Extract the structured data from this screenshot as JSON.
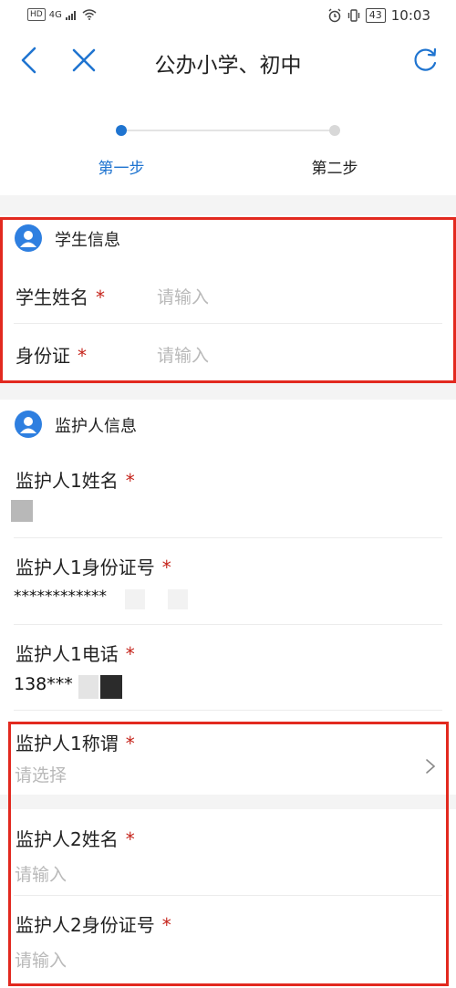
{
  "status_bar": {
    "hd": "HD",
    "network": "4G",
    "battery": "43",
    "time": "10:03"
  },
  "nav": {
    "title": "公办小学、初中"
  },
  "steps": {
    "step1": "第一步",
    "step2": "第二步"
  },
  "student_section": {
    "title": "学生信息",
    "fields": [
      {
        "label": "学生姓名",
        "required": "*",
        "placeholder": "请输入"
      },
      {
        "label": "身份证",
        "required": "*",
        "placeholder": "请输入"
      }
    ]
  },
  "guardian_section": {
    "title": "监护人信息",
    "fields": [
      {
        "label": "监护人1姓名",
        "required": "*",
        "value": ""
      },
      {
        "label": "监护人1身份证号",
        "required": "*",
        "value": "************"
      },
      {
        "label": "监护人1电话",
        "required": "*",
        "value": "138***"
      },
      {
        "label": "监护人1称谓",
        "required": "*",
        "placeholder": "请选择"
      },
      {
        "label": "监护人2姓名",
        "required": "*",
        "placeholder": "请输入"
      },
      {
        "label": "监护人2身份证号",
        "required": "*",
        "placeholder": "请输入"
      }
    ]
  },
  "colors": {
    "accent": "#1f74d0",
    "required": "#c5241b",
    "highlight_box": "#e2291f"
  }
}
